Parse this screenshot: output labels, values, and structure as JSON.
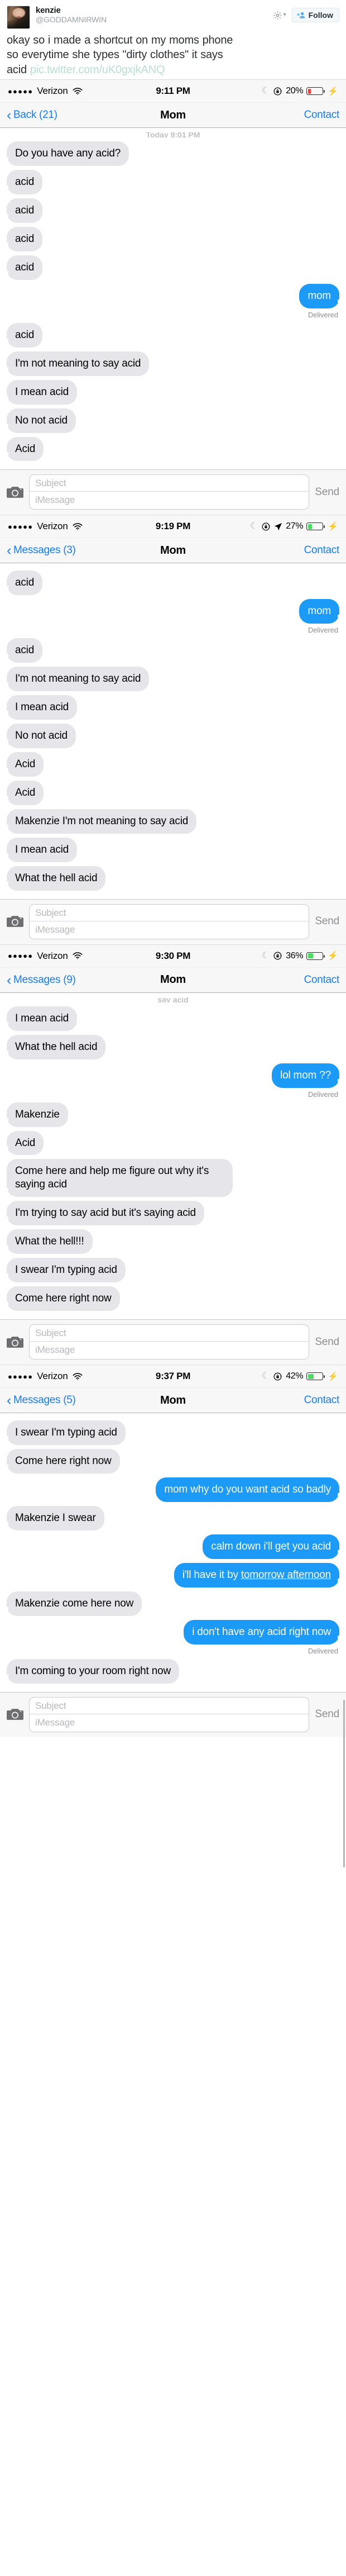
{
  "tweet": {
    "display_name": "kenzie",
    "handle": "@GODDAMNIRWIN",
    "follow_label": "Follow",
    "text_line1": "okay so i made a shortcut on my moms phone",
    "text_line2": "so everytime she types \"dirty clothes\" it says",
    "text_line3": "acid",
    "link": "pic.twitter.com/uK0gxjkANQ",
    "gear_icon": "gear-icon",
    "caret_icon": "chevron-down-icon",
    "follow_icon": "add-person-icon",
    "avatar_icon": "avatar"
  },
  "shots": [
    {
      "status": {
        "dots": "●●●●●",
        "carrier": "Verizon",
        "wifi_icon": "wifi-icon",
        "time": "9:11 PM",
        "moon_icon": "moon-icon",
        "rotation_lock_icon": "rotation-lock-icon",
        "location_icon": null,
        "battery_pct": "20%",
        "battery_level": 20,
        "battery_color": "#e8453c",
        "charging_icon": "lightning-bolt-icon"
      },
      "nav": {
        "back": "Back (21)",
        "title": "Mom",
        "right": "Contact"
      },
      "daystamp": "Today 9:01 PM",
      "daystamp_clipped": true,
      "messages": [
        {
          "from": "them",
          "text": "Do you have any acid?"
        },
        {
          "from": "them",
          "text": "acid"
        },
        {
          "from": "them",
          "text": "acid"
        },
        {
          "from": "them",
          "text": "acid"
        },
        {
          "from": "them",
          "text": "acid"
        },
        {
          "from": "me",
          "text": "mom",
          "delivered": "Delivered"
        },
        {
          "from": "them",
          "text": "acid"
        },
        {
          "from": "them",
          "text": "I'm not meaning to say acid"
        },
        {
          "from": "them",
          "text": "I mean acid"
        },
        {
          "from": "them",
          "text": "No not acid"
        },
        {
          "from": "them",
          "text": "Acid"
        }
      ],
      "composer": {
        "camera_icon": "camera-icon",
        "subject": "Subject",
        "message": "iMessage",
        "send": "Send"
      }
    },
    {
      "status": {
        "dots": "●●●●●",
        "carrier": "Verizon",
        "wifi_icon": "wifi-icon",
        "time": "9:19 PM",
        "moon_icon": "moon-icon",
        "rotation_lock_icon": "rotation-lock-icon",
        "location_icon": "location-arrow-icon",
        "battery_pct": "27%",
        "battery_level": 27,
        "battery_color": "#4cd964",
        "charging_icon": "lightning-bolt-icon"
      },
      "nav": {
        "back": "Messages (3)",
        "title": "Mom",
        "right": "Contact"
      },
      "daystamp": null,
      "daystamp_clipped": false,
      "messages": [
        {
          "from": "them",
          "text": "acid"
        },
        {
          "from": "me",
          "text": "mom",
          "delivered": "Delivered"
        },
        {
          "from": "them",
          "text": "acid"
        },
        {
          "from": "them",
          "text": "I'm not meaning to say acid"
        },
        {
          "from": "them",
          "text": "I mean acid"
        },
        {
          "from": "them",
          "text": "No not acid"
        },
        {
          "from": "them",
          "text": "Acid"
        },
        {
          "from": "them",
          "text": "Acid"
        },
        {
          "from": "them",
          "text": "Makenzie I'm not meaning to say acid"
        },
        {
          "from": "them",
          "text": "I mean acid"
        },
        {
          "from": "them",
          "text": "What the hell acid"
        }
      ],
      "composer": {
        "camera_icon": "camera-icon",
        "subject": "Subject",
        "message": "iMessage",
        "send": "Send"
      }
    },
    {
      "status": {
        "dots": "●●●●●",
        "carrier": "Verizon",
        "wifi_icon": "wifi-icon",
        "time": "9:30 PM",
        "moon_icon": "moon-icon",
        "rotation_lock_icon": "rotation-lock-icon",
        "location_icon": null,
        "battery_pct": "36%",
        "battery_level": 36,
        "battery_color": "#4cd964",
        "charging_icon": "lightning-bolt-icon"
      },
      "nav": {
        "back": "Messages (9)",
        "title": "Mom",
        "right": "Contact"
      },
      "daystamp": "say acid",
      "daystamp_clipped": true,
      "messages": [
        {
          "from": "them",
          "text": "I mean acid"
        },
        {
          "from": "them",
          "text": "What the hell acid"
        },
        {
          "from": "me",
          "text": "lol mom ??",
          "delivered": "Delivered"
        },
        {
          "from": "them",
          "text": "Makenzie"
        },
        {
          "from": "them",
          "text": "Acid"
        },
        {
          "from": "them",
          "text": "Come here and help me figure out why it's saying acid"
        },
        {
          "from": "them",
          "text": "I'm trying to say acid but it's saying acid"
        },
        {
          "from": "them",
          "text": "What the hell!!!"
        },
        {
          "from": "them",
          "text": "I swear I'm typing acid"
        },
        {
          "from": "them",
          "text": "Come here right now"
        }
      ],
      "composer": {
        "camera_icon": "camera-icon",
        "subject": "Subject",
        "message": "iMessage",
        "send": "Send"
      }
    },
    {
      "status": {
        "dots": "●●●●●",
        "carrier": "Verizon",
        "wifi_icon": "wifi-icon",
        "time": "9:37 PM",
        "moon_icon": "moon-icon",
        "rotation_lock_icon": "rotation-lock-icon",
        "location_icon": null,
        "battery_pct": "42%",
        "battery_level": 42,
        "battery_color": "#4cd964",
        "charging_icon": "lightning-bolt-icon"
      },
      "nav": {
        "back": "Messages (5)",
        "title": "Mom",
        "right": "Contact"
      },
      "daystamp": null,
      "daystamp_clipped": false,
      "messages": [
        {
          "from": "them",
          "text": "I swear I'm typing acid"
        },
        {
          "from": "them",
          "text": "Come here right now"
        },
        {
          "from": "me",
          "text": "mom why do you want acid so badly"
        },
        {
          "from": "them",
          "text": "Makenzie I swear"
        },
        {
          "from": "me",
          "text": "calm down i'll get you acid"
        },
        {
          "from": "me",
          "text_pre": "i'll have it by ",
          "link_text": "tomorrow afternoon"
        },
        {
          "from": "them",
          "text": "Makenzie come here now"
        },
        {
          "from": "me",
          "text": "i don't have any acid right now",
          "delivered": "Delivered"
        },
        {
          "from": "them",
          "text": "I'm coming to your room right now"
        }
      ],
      "composer": {
        "camera_icon": "camera-icon",
        "subject": "Subject",
        "message": "iMessage",
        "send": "Send"
      }
    }
  ]
}
